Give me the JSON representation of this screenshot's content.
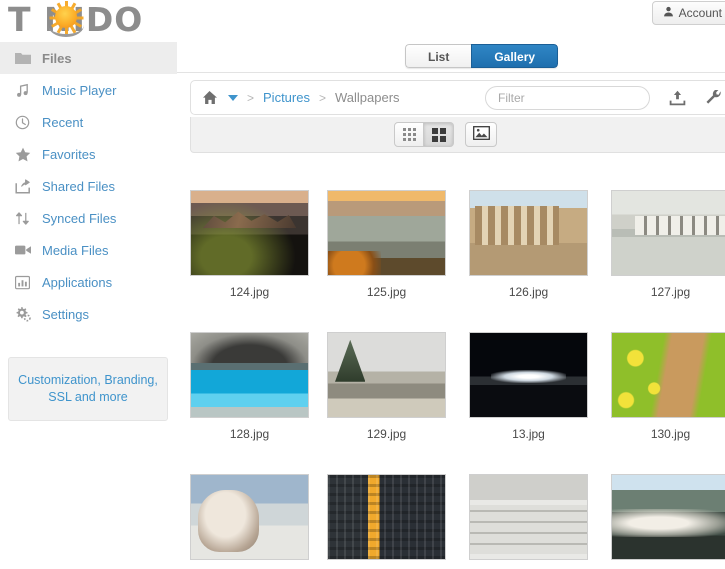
{
  "header": {
    "logo_text": "T NIDO",
    "logo_prefix": "T",
    "logo_suffix": "NIDO",
    "account_label": "Account",
    "account_icon": "user-icon",
    "sun_icon": "sun-logo-icon"
  },
  "sidebar": {
    "items": [
      {
        "label": "Files",
        "icon": "folder-icon",
        "active": true
      },
      {
        "label": "Music Player",
        "icon": "music-note-icon",
        "active": false
      },
      {
        "label": "Recent",
        "icon": "clock-icon",
        "active": false
      },
      {
        "label": "Favorites",
        "icon": "star-icon",
        "active": false
      },
      {
        "label": "Shared Files",
        "icon": "share-icon",
        "active": false
      },
      {
        "label": "Synced Files",
        "icon": "sync-arrows-icon",
        "active": false
      },
      {
        "label": "Media Files",
        "icon": "video-camera-icon",
        "active": false
      },
      {
        "label": "Applications",
        "icon": "bar-chart-icon",
        "active": false
      },
      {
        "label": "Settings",
        "icon": "gears-icon",
        "active": false
      }
    ],
    "promo": "Customization, Branding, SSL and more"
  },
  "main": {
    "view_toggle": {
      "list_label": "List",
      "gallery_label": "Gallery",
      "selected": "Gallery"
    },
    "breadcrumb": {
      "home_icon": "home-icon",
      "dropdown_icon": "chevron-down-icon",
      "separator": ">",
      "crumbs": [
        {
          "label": "Pictures",
          "current": false
        },
        {
          "label": "Wallpapers",
          "current": true
        }
      ]
    },
    "filter": {
      "value": "",
      "placeholder": "Filter"
    },
    "toolbar_icons": [
      {
        "name": "upload-icon"
      },
      {
        "name": "wrench-icon"
      }
    ],
    "view_modes": [
      {
        "name": "small-grid-view-button",
        "selected": false
      },
      {
        "name": "large-grid-view-button",
        "selected": true
      },
      {
        "name": "single-image-view-button",
        "selected": false
      }
    ],
    "gallery": {
      "files": [
        {
          "name": "124.jpg",
          "art": "a124"
        },
        {
          "name": "125.jpg",
          "art": "a125"
        },
        {
          "name": "126.jpg",
          "art": "a126"
        },
        {
          "name": "127.jpg",
          "art": "a127"
        },
        {
          "name": "128.jpg",
          "art": "a128"
        },
        {
          "name": "129.jpg",
          "art": "a129"
        },
        {
          "name": "13.jpg",
          "art": "a13"
        },
        {
          "name": "130.jpg",
          "art": "a130"
        },
        {
          "name": "",
          "art": "a131"
        },
        {
          "name": "",
          "art": "a132"
        },
        {
          "name": "",
          "art": "a133"
        },
        {
          "name": "",
          "art": "a134"
        }
      ]
    }
  },
  "colors": {
    "accent_blue": "#3f94cc",
    "tab_active_blue": "#2f86c5",
    "sidebar_active_bg": "#ededed",
    "toolbar_bg": "#f1f1f1",
    "logo_gray": "#8d8d8d",
    "sun_orange": "#f5a623"
  }
}
